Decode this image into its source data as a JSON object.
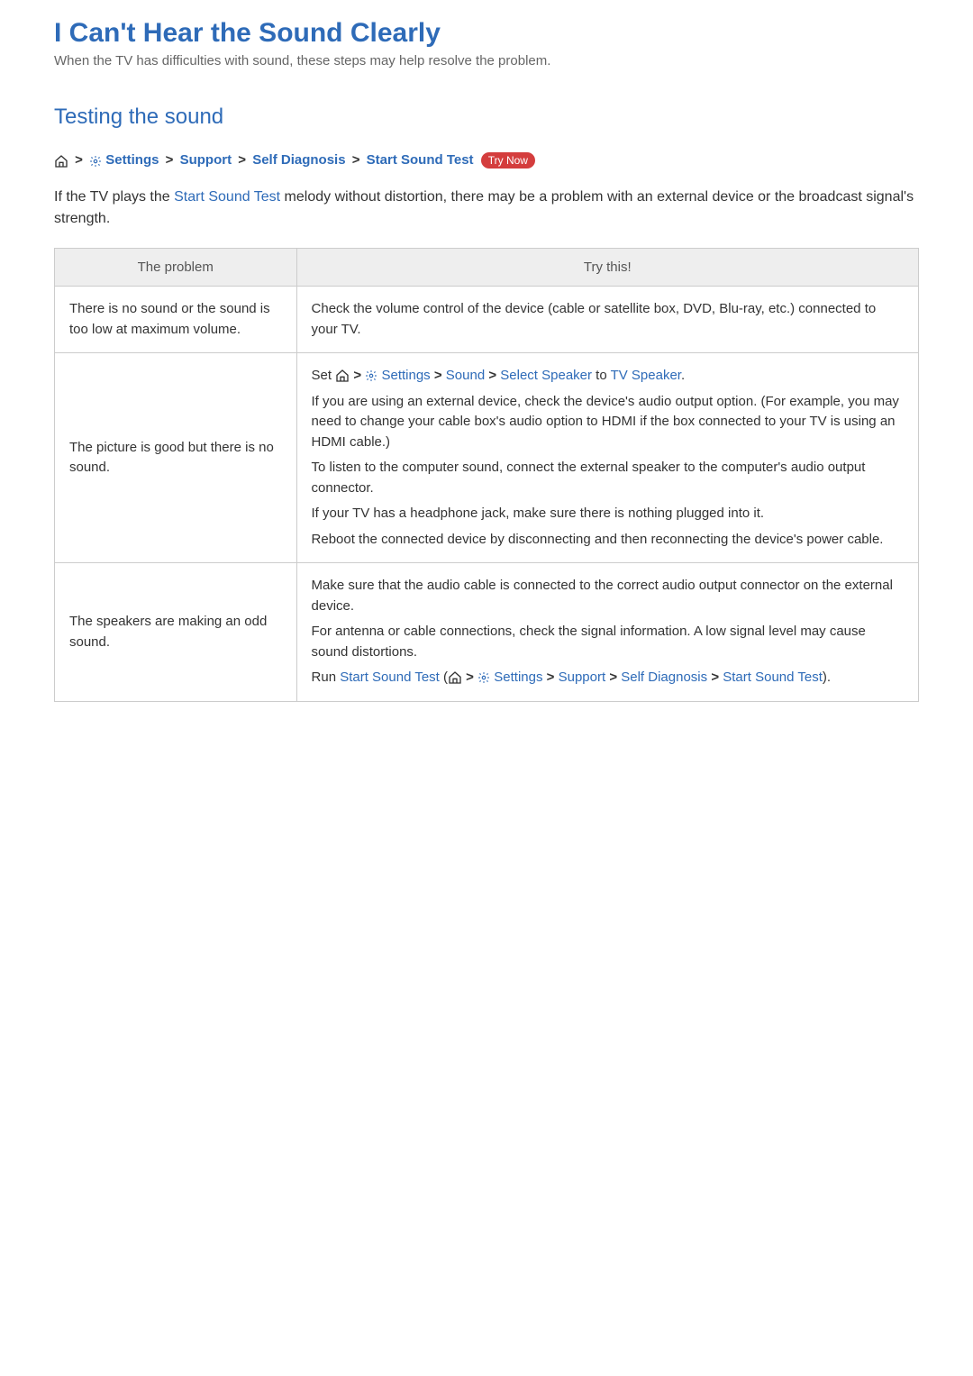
{
  "page_title": "I Can't Hear the Sound Clearly",
  "subtitle": "When the TV has difficulties with sound, these steps may help resolve the problem.",
  "section_heading": "Testing the sound",
  "breadcrumb": {
    "settings": "Settings",
    "support": "Support",
    "self_diagnosis": "Self Diagnosis",
    "start_sound_test": "Start Sound Test",
    "try_now": "Try Now"
  },
  "intro": {
    "part1": "If the TV plays the ",
    "start_sound_test": "Start Sound Test",
    "part2": " melody without distortion, there may be a problem with an external device or the broadcast signal's strength."
  },
  "table": {
    "header_problem": "The problem",
    "header_try": "Try this!",
    "rows": [
      {
        "problem": "There is no sound or the sound is too low at maximum volume.",
        "solution_plain": "Check the volume control of the device (cable or satellite box, DVD, Blu-ray, etc.) connected to your TV."
      },
      {
        "problem": "The picture is good but there is no sound.",
        "solution": {
          "set_prefix": "Set ",
          "settings": "Settings",
          "sound": "Sound",
          "select_speaker": "Select Speaker",
          "to": " to ",
          "tv_speaker": "TV Speaker",
          "period": ".",
          "p2": "If you are using an external device, check the device's audio output option. (For example, you may need to change your cable box's audio option to HDMI if the box connected to your TV is using an HDMI cable.)",
          "p3": "To listen to the computer sound, connect the external speaker to the computer's audio output connector.",
          "p4": "If your TV has a headphone jack, make sure there is nothing plugged into it.",
          "p5": "Reboot the connected device by disconnecting and then reconnecting the device's power cable."
        }
      },
      {
        "problem": "The speakers are making an odd sound.",
        "solution": {
          "p1": "Make sure that the audio cable is connected to the correct audio output connector on the external device.",
          "p2": "For antenna or cable connections, check the signal information. A low signal level may cause sound distortions.",
          "run_prefix": "Run ",
          "start_sound_test": "Start Sound Test",
          "open_paren": " (",
          "settings": "Settings",
          "support": "Support",
          "self_diagnosis": "Self Diagnosis",
          "start_sound_test2": "Start Sound Test",
          "close_paren": ")."
        }
      }
    ]
  }
}
